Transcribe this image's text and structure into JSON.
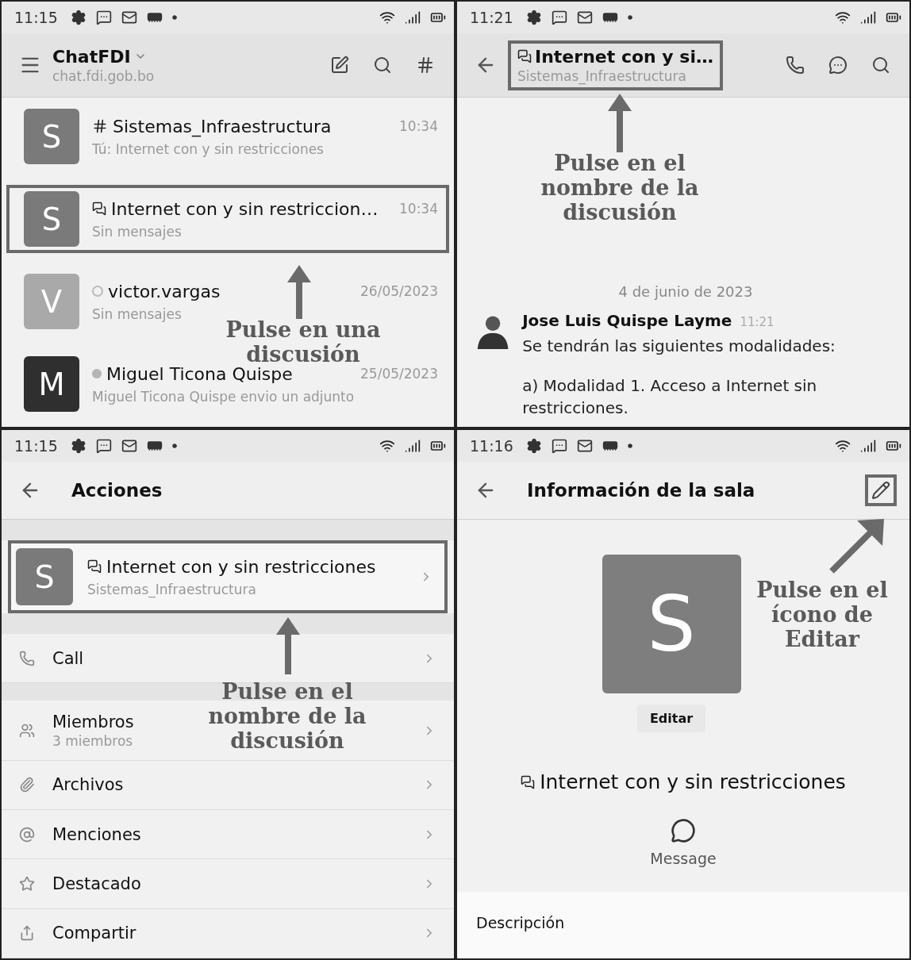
{
  "chat_list": {
    "status_time": "11:15",
    "workspace": "ChatFDI",
    "server": "chat.fdi.gob.bo",
    "rooms": [
      {
        "kind": "channel",
        "avatar": "S",
        "color": "#7a7a7a",
        "name": "Sistemas_Infraestructura",
        "time": "10:34",
        "preview": "Tú: Internet con y sin restricciones",
        "highlighted": false
      },
      {
        "kind": "discussion",
        "avatar": "S",
        "color": "#7a7a7a",
        "name": "Internet con y sin restriccion…",
        "time": "10:34",
        "preview": "Sin mensajes",
        "highlighted": true
      },
      {
        "kind": "offline",
        "avatar": "V",
        "color": "#a9a9a9",
        "name": "victor.vargas",
        "time": "26/05/2023",
        "preview": "Sin mensajes",
        "highlighted": false
      },
      {
        "kind": "away",
        "avatar": "M",
        "color": "#2f2f2f",
        "name": "Miguel Ticona Quispe",
        "time": "25/05/2023",
        "preview": "Miguel Ticona Quispe envio un adjunto",
        "highlighted": false
      }
    ],
    "annotation": "Pulse en una\ndiscusión"
  },
  "discussion": {
    "status_time": "11:21",
    "title": "Internet con y si…",
    "subtitle": "Sistemas_Infraestructura",
    "title_highlighted": true,
    "annotation": "Pulse en el\nnombre de la\ndiscusión",
    "date": "4 de junio de 2023",
    "message": {
      "author": "Jose Luis Quispe Layme",
      "time": "11:21",
      "lines": [
        "Se tendrán las siguientes modalidades:",
        "a) Modalidad 1. Acceso a Internet sin restricciones."
      ]
    }
  },
  "actions": {
    "status_time": "11:15",
    "title": "Acciones",
    "room": {
      "avatar": "S",
      "name": "Internet con y sin restricciones",
      "parent": "Sistemas_Infraestructura",
      "highlighted": true
    },
    "items": [
      {
        "kind": "call",
        "label": "Call"
      },
      {
        "kind": "members",
        "label": "Miembros",
        "detail": "3 miembros"
      },
      {
        "kind": "files",
        "label": "Archivos"
      },
      {
        "kind": "mentions",
        "label": "Menciones"
      },
      {
        "kind": "starred",
        "label": "Destacado"
      },
      {
        "kind": "share",
        "label": "Compartir"
      }
    ],
    "annotation": "Pulse en el\nnombre de la\ndiscusión"
  },
  "room_info": {
    "status_time": "11:16",
    "title": "Información de la sala",
    "edit_highlighted": true,
    "avatar": "S",
    "edit_label": "Editar",
    "room_name": "Internet con y sin restricciones",
    "message_label": "Message",
    "description_label": "Descripción",
    "annotation": "Pulse en el\nícono de\nEditar"
  }
}
